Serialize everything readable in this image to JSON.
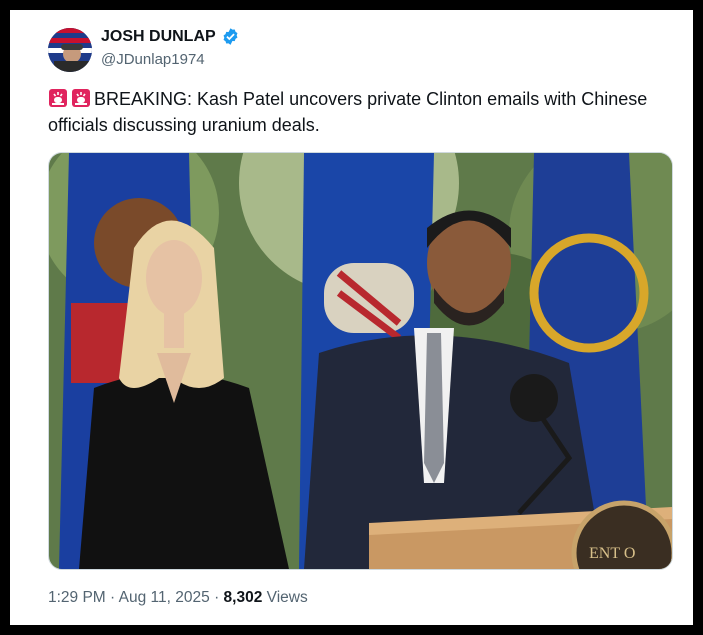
{
  "tweet": {
    "author_name": "JOSH DUNLAP",
    "author_handle": "@JDunlap1974",
    "text": "BREAKING: Kash Patel uncovers private Clinton emails with Chinese officials discussing uranium deals.",
    "leading_icons": [
      "siren-icon",
      "siren-icon"
    ],
    "time": "1:29 PM",
    "date": "Aug 11, 2025",
    "views_count": "8,302",
    "views_label": "Views",
    "separator": "·"
  },
  "photo": {
    "podium_text": "ENT O"
  },
  "colors": {
    "verified": "#1d9bf0",
    "text_primary": "#0f1419",
    "text_secondary": "#536471"
  }
}
